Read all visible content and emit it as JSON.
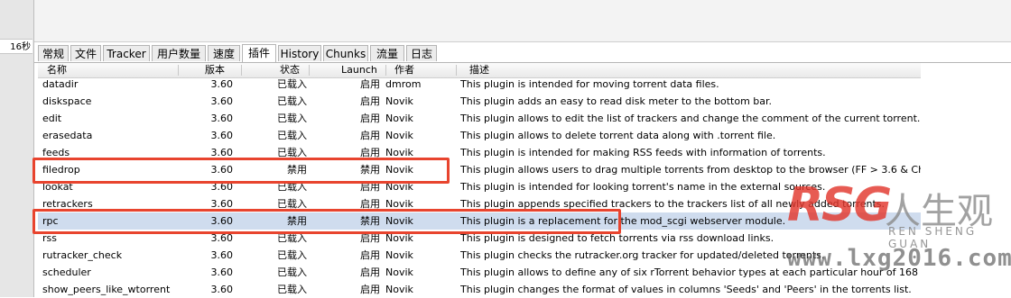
{
  "left_panel": {
    "cell_text": "16秒"
  },
  "tabs": [
    {
      "label": "常规",
      "active": false
    },
    {
      "label": "文件",
      "active": false
    },
    {
      "label": "Tracker",
      "active": false
    },
    {
      "label": "用户数量",
      "active": false
    },
    {
      "label": "速度",
      "active": false
    },
    {
      "label": "插件",
      "active": true
    },
    {
      "label": "History",
      "active": false
    },
    {
      "label": "Chunks",
      "active": false
    },
    {
      "label": "流量",
      "active": false
    },
    {
      "label": "日志",
      "active": false
    }
  ],
  "table": {
    "columns": {
      "name": "名称",
      "version": "版本",
      "status": "状态",
      "launch": "Launch",
      "author": "作者",
      "description": "描述"
    },
    "rows": [
      {
        "name": "datadir",
        "version": "3.60",
        "status": "已载入",
        "launch": "启用",
        "author": "dmrom",
        "description": "This plugin is intended for moving torrent data files."
      },
      {
        "name": "diskspace",
        "version": "3.60",
        "status": "已载入",
        "launch": "启用",
        "author": "Novik",
        "description": "This plugin adds an easy to read disk meter to the bottom bar."
      },
      {
        "name": "edit",
        "version": "3.60",
        "status": "已载入",
        "launch": "启用",
        "author": "Novik",
        "description": "This plugin allows to edit the list of trackers and change the comment of the current torrent."
      },
      {
        "name": "erasedata",
        "version": "3.60",
        "status": "已载入",
        "launch": "启用",
        "author": "Novik",
        "description": "This plugin allows to delete torrent data along with .torrent file."
      },
      {
        "name": "feeds",
        "version": "3.60",
        "status": "已载入",
        "launch": "启用",
        "author": "Novik",
        "description": "This plugin is intended for making RSS feeds with information of torrents."
      },
      {
        "name": "filedrop",
        "version": "3.60",
        "status": "禁用",
        "launch": "禁用",
        "author": "Novik",
        "description": "This plugin allows users to drag multiple torrents from desktop to the browser (FF > 3.6 & Ch"
      },
      {
        "name": "lookat",
        "version": "3.60",
        "status": "已载入",
        "launch": "启用",
        "author": "Novik",
        "description": "This plugin is intended for looking torrent's name in the external sources."
      },
      {
        "name": "retrackers",
        "version": "3.60",
        "status": "已载入",
        "launch": "启用",
        "author": "Novik",
        "description": "This plugin appends specified trackers to the trackers list of all newly added torrents."
      },
      {
        "name": "rpc",
        "version": "3.60",
        "status": "禁用",
        "launch": "禁用",
        "author": "Novik",
        "description": "This plugin is a replacement for the mod_scgi webserver module."
      },
      {
        "name": "rss",
        "version": "3.60",
        "status": "已载入",
        "launch": "启用",
        "author": "Novik",
        "description": "This plugin is designed to fetch torrents via rss download links."
      },
      {
        "name": "rutracker_check",
        "version": "3.60",
        "status": "已载入",
        "launch": "启用",
        "author": "Novik",
        "description": "This plugin checks the rutracker.org tracker for updated/deleted torrents."
      },
      {
        "name": "scheduler",
        "version": "3.60",
        "status": "已载入",
        "launch": "启用",
        "author": "Novik",
        "description": "This plugin allows to define any of six rTorrent behavior types at each particular hour of 168 v"
      },
      {
        "name": "show_peers_like_wtorrent",
        "version": "3.60",
        "status": "已载入",
        "launch": "启用",
        "author": "Novik",
        "description": "This plugin changes the format of values in columns 'Seeds' and 'Peers' in the torrents list."
      }
    ]
  },
  "watermark": {
    "brand": "RSG",
    "cn": "人生观",
    "sub": "REN SHENG GUAN",
    "url": "www.lxg2016.com"
  },
  "colors": {
    "highlight_box": "#e8442e",
    "selected_row": "#cfdcee",
    "watermark_red": "#e2382e"
  }
}
